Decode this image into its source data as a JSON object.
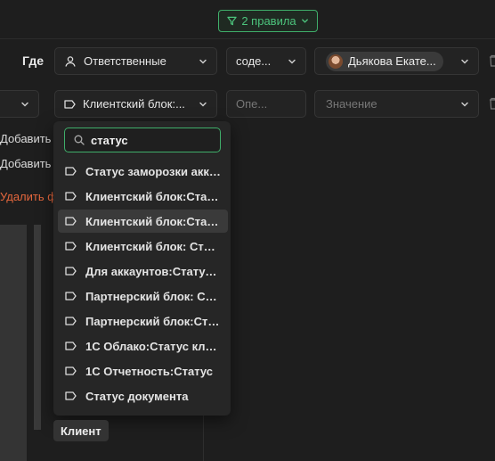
{
  "rules_button": {
    "label": "2 правила"
  },
  "filter": {
    "where_label": "Где",
    "row1": {
      "field": "Ответственные",
      "operator": "соде...",
      "value_user": "Дьякова Екате..."
    },
    "row2": {
      "field": "Клиентский блок:...",
      "operator_placeholder": "Опе...",
      "value_placeholder": "Значение"
    }
  },
  "side": {
    "add1": "Добавить п",
    "add2": "Добавить п",
    "delete": "Удалить фи"
  },
  "dropdown": {
    "search_value": "статус",
    "options": [
      "Статус заморозки акка...",
      "Клиентский блок:Стату...",
      "Клиентский блок:Стату...",
      "Клиентский блок: Стату...",
      "Для аккаунтов:Статус ...",
      "Партнерский блок: Ста...",
      "Партнерский блок:Стат...",
      "1С Облако:Статус клие...",
      "1С Отчетность:Статус",
      "Статус документа"
    ],
    "highlighted_index": 2
  },
  "tooltip": "Клиент",
  "colors": {
    "accent": "#3fae6a",
    "danger": "#e5673d",
    "bg": "#1e1e1e"
  }
}
